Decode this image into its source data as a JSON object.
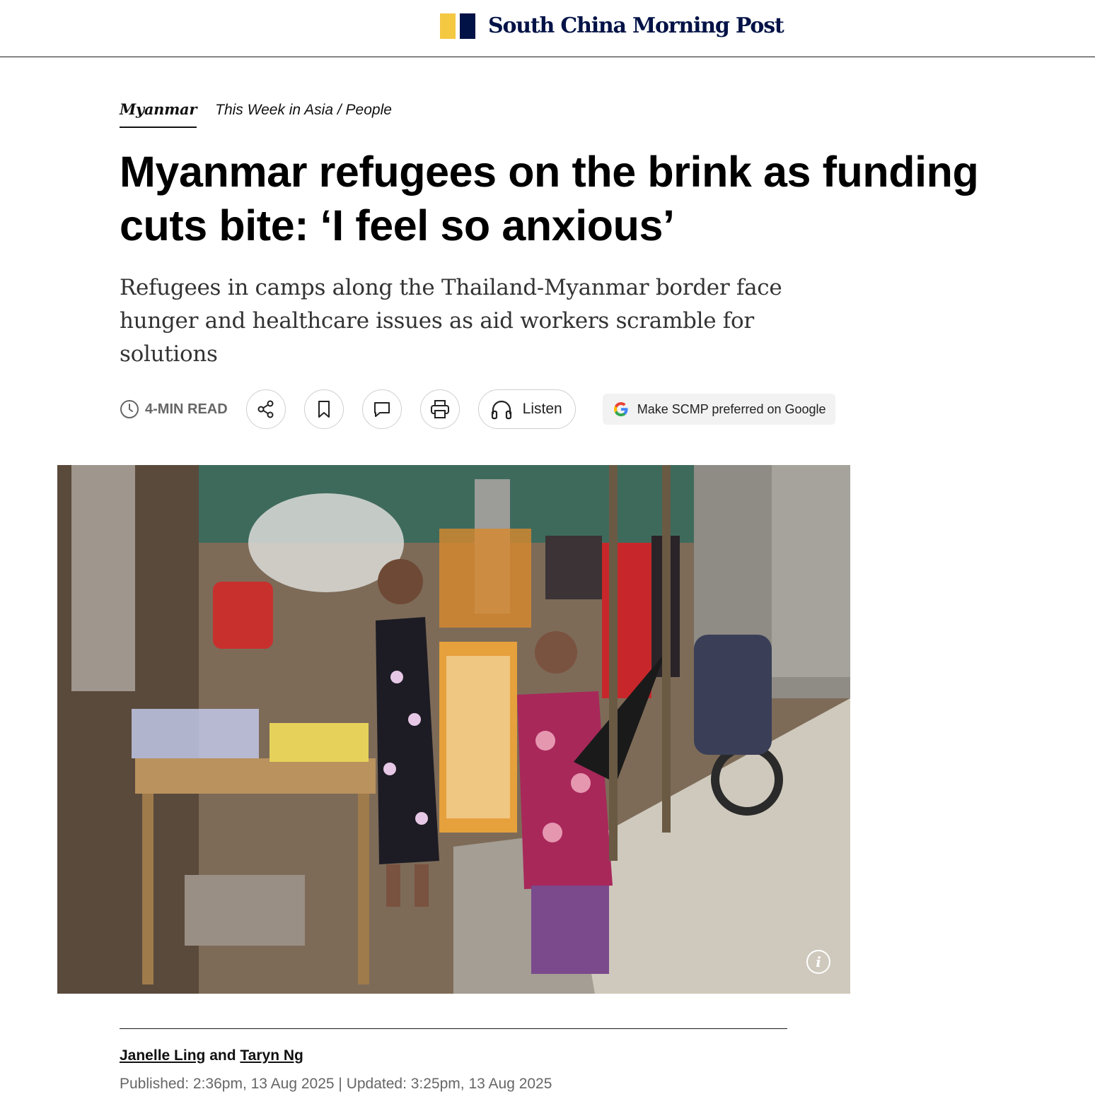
{
  "header": {
    "logo_text": "South China Morning Post",
    "brand_colors": {
      "yellow": "#f5c842",
      "navy": "#001246"
    }
  },
  "breadcrumbs": {
    "primary": "Myanmar",
    "secondary_1": "This Week in Asia",
    "separator": " / ",
    "secondary_2": "People"
  },
  "article": {
    "headline_line1": "Myanmar refugees on the brink as funding",
    "headline_line2": "cuts bite: ‘I feel so anxious’",
    "subheadline": "Refugees in camps along the Thailand-Myanmar border face hunger and healthcare issues as aid workers scramble for solutions"
  },
  "actions": {
    "read_time": "4-MIN READ",
    "clock_icon": "clock-icon",
    "share_icon": "share-icon",
    "bookmark_icon": "bookmark-icon",
    "comment_icon": "comment-icon",
    "print_icon": "print-icon",
    "headphones_icon": "headphones-icon",
    "listen_label": "Listen",
    "google_label": "Make SCMP preferred on Google"
  },
  "hero_image": {
    "info_icon": "info-icon",
    "info_glyph": "i"
  },
  "byline": {
    "author_1": "Janelle Ling",
    "joiner": " and ",
    "author_2": "Taryn Ng",
    "dates": "Published: 2:36pm, 13 Aug 2025 | Updated: 3:25pm, 13 Aug 2025"
  }
}
